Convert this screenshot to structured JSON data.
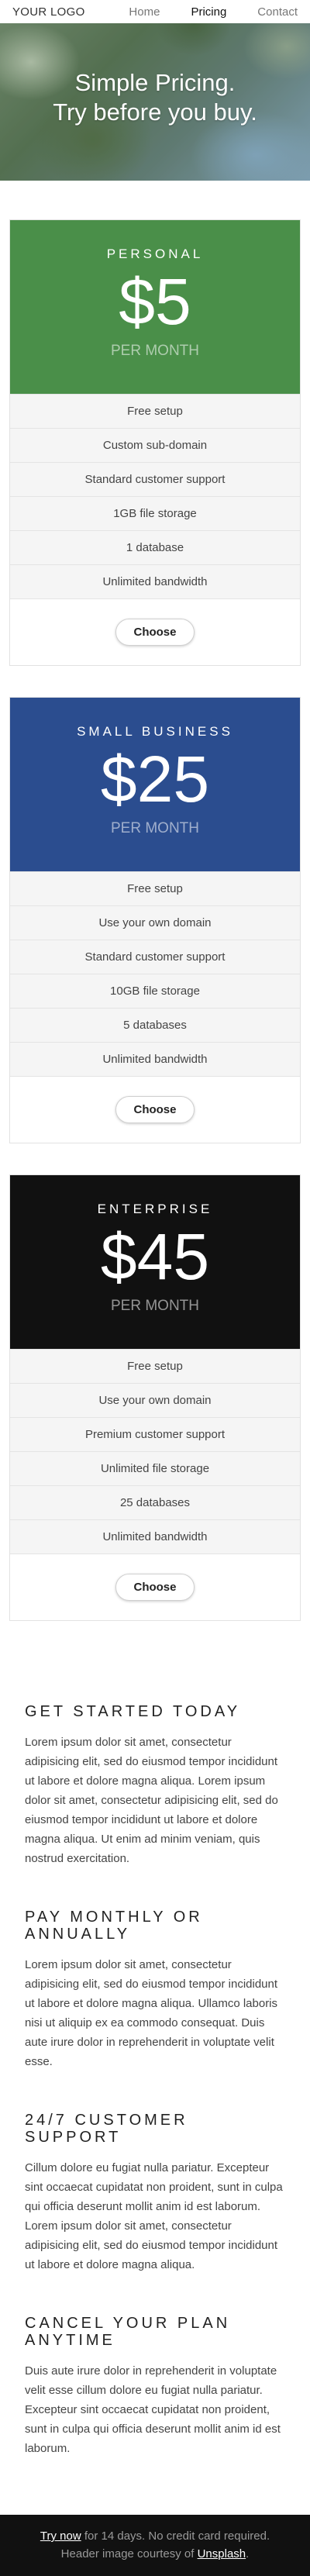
{
  "nav": {
    "logo": "YOUR LOGO",
    "links": [
      {
        "label": "Home",
        "active": false
      },
      {
        "label": "Pricing",
        "active": true
      },
      {
        "label": "Contact",
        "active": false
      }
    ]
  },
  "hero": {
    "title_line1": "Simple Pricing.",
    "title_line2": "Try before you buy."
  },
  "plans": [
    {
      "name": "Personal",
      "price": "$5",
      "period": "PER MONTH",
      "color": "#4a8f49",
      "features": [
        "Free setup",
        "Custom sub-domain",
        "Standard customer support",
        "1GB file storage",
        "1 database",
        "Unlimited bandwidth"
      ],
      "button": "Choose"
    },
    {
      "name": "Small Business",
      "price": "$25",
      "period": "PER MONTH",
      "color": "#2b4d8f",
      "features": [
        "Free setup",
        "Use your own domain",
        "Standard customer support",
        "10GB file storage",
        "5 databases",
        "Unlimited bandwidth"
      ],
      "button": "Choose"
    },
    {
      "name": "Enterprise",
      "price": "$45",
      "period": "PER MONTH",
      "color": "#111111",
      "features": [
        "Free setup",
        "Use your own domain",
        "Premium customer support",
        "Unlimited file storage",
        "25 databases",
        "Unlimited bandwidth"
      ],
      "button": "Choose"
    }
  ],
  "faq": [
    {
      "title": "Get started today",
      "body": "Lorem ipsum dolor sit amet, consectetur adipisicing elit, sed do eiusmod tempor incididunt ut labore et dolore magna aliqua. Lorem ipsum dolor sit amet, consectetur adipisicing elit, sed do eiusmod tempor incididunt ut labore et dolore magna aliqua. Ut enim ad minim veniam, quis nostrud exercitation."
    },
    {
      "title": "Pay monthly or annually",
      "body": "Lorem ipsum dolor sit amet, consectetur adipisicing elit, sed do eiusmod tempor incididunt ut labore et dolore magna aliqua. Ullamco laboris nisi ut aliquip ex ea commodo consequat. Duis aute irure dolor in reprehenderit in voluptate velit esse."
    },
    {
      "title": "24/7 customer support",
      "body": "Cillum dolore eu fugiat nulla pariatur. Excepteur sint occaecat cupidatat non proident, sunt in culpa qui officia deserunt mollit anim id est laborum. Lorem ipsum dolor sit amet, consectetur adipisicing elit, sed do eiusmod tempor incididunt ut labore et dolore magna aliqua."
    },
    {
      "title": "Cancel your plan anytime",
      "body": "Duis aute irure dolor in reprehenderit in voluptate velit esse cillum dolore eu fugiat nulla pariatur. Excepteur sint occaecat cupidatat non proident, sunt in culpa qui officia deserunt mollit anim id est laborum."
    }
  ],
  "footer": {
    "try_link": "Try now",
    "try_text": " for 14 days. No credit card required.",
    "credit_text": "Header image courtesy of ",
    "credit_link": "Unsplash",
    "credit_end": "."
  }
}
